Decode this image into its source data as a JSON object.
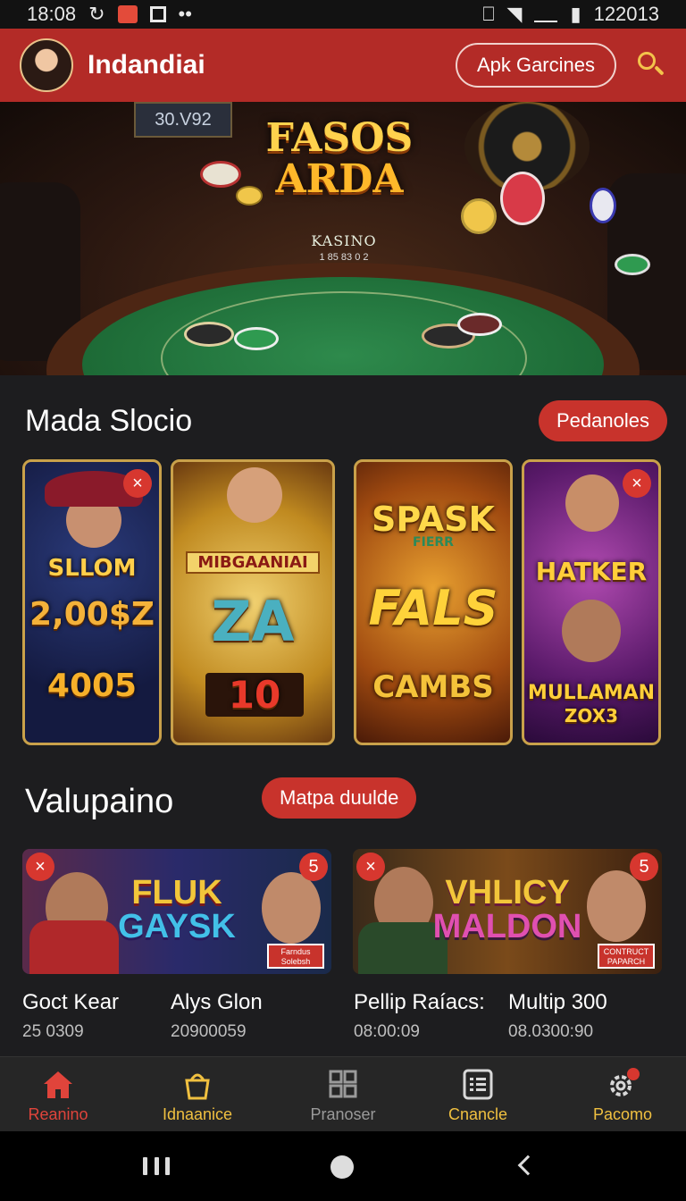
{
  "status_bar": {
    "time": "18:08",
    "right_text": "122013"
  },
  "app": {
    "title": "Indandiai",
    "apk_button": "Apk Garcines"
  },
  "hero": {
    "line1": "FASOS",
    "line2": "ARDA",
    "felt_text": "KASINO",
    "felt_sub": "1 85 83 0 2",
    "wall_sign": "30.V92"
  },
  "section1": {
    "title": "Mada Slocio",
    "button": "Pedanoles",
    "cards": [
      {
        "close": "×",
        "lines": [
          "SLLOM",
          "2,00$Z",
          "4005"
        ]
      },
      {
        "lines": [
          "MIBGAANIAI",
          "ZA",
          "10"
        ]
      },
      {
        "lines": [
          "SPASK",
          "FIERR",
          "FALS",
          "CAMBS"
        ]
      },
      {
        "close": "×",
        "lines": [
          "HATKER",
          "MULLAMAN",
          "ZOX3"
        ]
      }
    ]
  },
  "section2": {
    "title": "Valupaino",
    "button": "Matpa duulde",
    "promos": [
      {
        "close": "×",
        "count": "5",
        "title_l1": "FLUK",
        "title_l2": "GAYSK",
        "badge": "Farndus Solebsh",
        "items": [
          {
            "name": "Goct Kear",
            "value": "25 0309"
          },
          {
            "name": "Alys Glon",
            "value": "20900059"
          }
        ]
      },
      {
        "close": "×",
        "count": "5",
        "title_l1": "VHLICY",
        "title_l2": "MALDON",
        "badge": "CONTRUCT PAPARCH",
        "items": [
          {
            "name": "Pellip Raíacs:",
            "value": "08:00:09"
          },
          {
            "name": "Multip 300",
            "value": "08.0300:90"
          }
        ]
      }
    ]
  },
  "bottom_nav": [
    {
      "label": "Reanino",
      "icon": "home-icon",
      "color": "#e0443b"
    },
    {
      "label": "Idnaanice",
      "icon": "bucket-icon",
      "color": "#f0c040"
    },
    {
      "label": "Pranoser",
      "icon": "grid-icon",
      "color": "#9a9a9a"
    },
    {
      "label": "Cnancle",
      "icon": "list-icon",
      "color": "#f0c040"
    },
    {
      "label": "Pacomo",
      "icon": "gear-icon",
      "color": "#f0c040"
    }
  ]
}
